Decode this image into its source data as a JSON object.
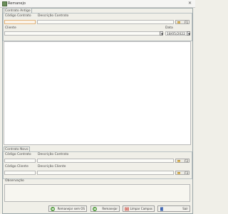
{
  "window": {
    "title": "Remanejo",
    "close_glyph": "✕"
  },
  "old_contract": {
    "caption": "Contrato Antigo",
    "code_label": "Código Contrato",
    "description_label": "Descrição Contrato",
    "search_button": "F1",
    "client_label": "Cliente",
    "date_label": "Data",
    "date_value": "18/05/2022"
  },
  "new_contract": {
    "caption": "Contrato Novo",
    "code_label": "Código Contrato",
    "description_label": "Descrição Contrato",
    "search_button": "F2",
    "client_code_label": "Código Cliente",
    "client_description_label": "Descrição Cliente",
    "client_search_button": "F3",
    "observation_label": "Observação"
  },
  "actions": {
    "remanejar_sem_os": "Remanejar sem OS",
    "remanejar": "Remanejar",
    "limpar_campos": "Limpar Campos",
    "sair": "Sair"
  },
  "icons": {
    "app": "app-icon",
    "search": "search-icon",
    "arrow": "arrow-right-icon",
    "clear": "eraser-icon",
    "exit": "exit-door-icon"
  },
  "colors": {
    "accent_green": "#4f9a3a",
    "clear_red": "#c0392b",
    "exit_blue": "#3a62b0",
    "required_field": "#e0b27a"
  }
}
